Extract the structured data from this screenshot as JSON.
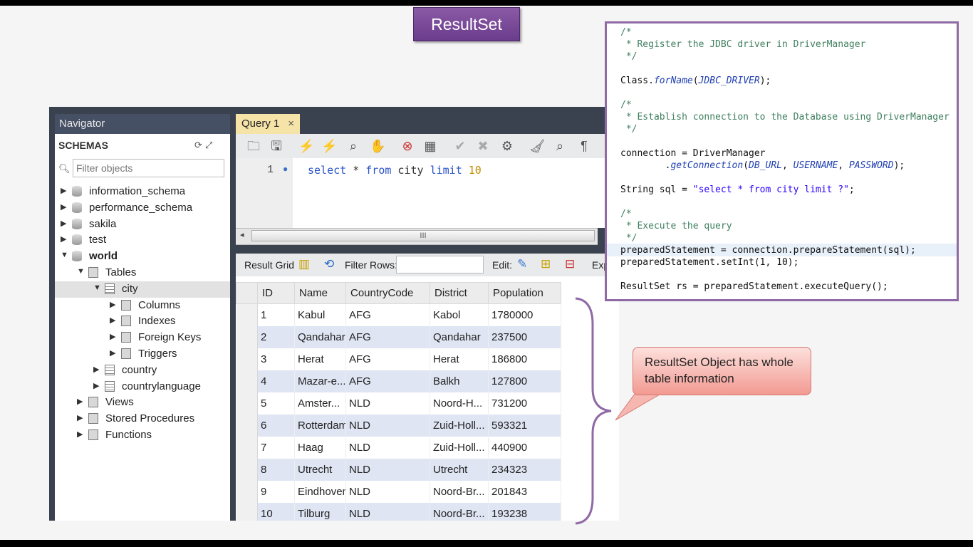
{
  "slide_title": "ResultSet",
  "navigator": {
    "title": "Navigator",
    "schemas_label": "SCHEMAS",
    "filter_placeholder": "Filter objects",
    "tree": [
      {
        "label": "information_schema",
        "level": 0,
        "icon": "database-icon",
        "expanded": false
      },
      {
        "label": "performance_schema",
        "level": 0,
        "icon": "database-icon",
        "expanded": false
      },
      {
        "label": "sakila",
        "level": 0,
        "icon": "database-icon",
        "expanded": false
      },
      {
        "label": "test",
        "level": 0,
        "icon": "database-icon",
        "expanded": false
      },
      {
        "label": "world",
        "level": 0,
        "icon": "database-icon",
        "expanded": true,
        "bold": true
      },
      {
        "label": "Tables",
        "level": 1,
        "icon": "folder-icon",
        "expanded": true
      },
      {
        "label": "city",
        "level": 2,
        "icon": "table-icon",
        "expanded": true,
        "selected": true
      },
      {
        "label": "Columns",
        "level": 3,
        "icon": "columns-icon",
        "expanded": false
      },
      {
        "label": "Indexes",
        "level": 3,
        "icon": "indexes-icon",
        "expanded": false
      },
      {
        "label": "Foreign Keys",
        "level": 3,
        "icon": "foreign-keys-icon",
        "expanded": false
      },
      {
        "label": "Triggers",
        "level": 3,
        "icon": "triggers-icon",
        "expanded": false
      },
      {
        "label": "country",
        "level": 2,
        "icon": "table-icon",
        "expanded": false
      },
      {
        "label": "countrylanguage",
        "level": 2,
        "icon": "table-icon",
        "expanded": false
      },
      {
        "label": "Views",
        "level": 1,
        "icon": "folder-icon",
        "expanded": false
      },
      {
        "label": "Stored Procedures",
        "level": 1,
        "icon": "folder-icon",
        "expanded": false
      },
      {
        "label": "Functions",
        "level": 1,
        "icon": "folder-icon",
        "expanded": false
      }
    ]
  },
  "query": {
    "tab_label": "Query 1",
    "tab_close": "×",
    "line_number": "1",
    "sql_tokens": [
      {
        "text": "select",
        "cls": "kw"
      },
      {
        "text": " * ",
        "cls": ""
      },
      {
        "text": "from",
        "cls": "kw"
      },
      {
        "text": " city ",
        "cls": ""
      },
      {
        "text": "limit",
        "cls": "kw"
      },
      {
        "text": " ",
        "cls": ""
      },
      {
        "text": "10",
        "cls": "num"
      }
    ],
    "scroll_thumb": "III"
  },
  "result": {
    "result_grid_label": "Result Grid",
    "filter_rows_label": "Filter Rows:",
    "edit_label": "Edit:",
    "export_label": "Exp",
    "columns": [
      "ID",
      "Name",
      "CountryCode",
      "District",
      "Population"
    ],
    "rows": [
      [
        "1",
        "Kabul",
        "AFG",
        "Kabol",
        "1780000"
      ],
      [
        "2",
        "Qandahar",
        "AFG",
        "Qandahar",
        "237500"
      ],
      [
        "3",
        "Herat",
        "AFG",
        "Herat",
        "186800"
      ],
      [
        "4",
        "Mazar-e...",
        "AFG",
        "Balkh",
        "127800"
      ],
      [
        "5",
        "Amster...",
        "NLD",
        "Noord-H...",
        "731200"
      ],
      [
        "6",
        "Rotterdam",
        "NLD",
        "Zuid-Holl...",
        "593321"
      ],
      [
        "7",
        "Haag",
        "NLD",
        "Zuid-Holl...",
        "440900"
      ],
      [
        "8",
        "Utrecht",
        "NLD",
        "Utrecht",
        "234323"
      ],
      [
        "9",
        "Eindhoven",
        "NLD",
        "Noord-Br...",
        "201843"
      ],
      [
        "10",
        "Tilburg",
        "NLD",
        "Noord-Br...",
        "193238"
      ]
    ]
  },
  "code_panel": {
    "lines": [
      [
        {
          "t": "/*",
          "c": "cm"
        }
      ],
      [
        {
          "t": " * Register the JDBC driver in DriverManager",
          "c": "cm"
        }
      ],
      [
        {
          "t": " */",
          "c": "cm"
        }
      ],
      [],
      [
        {
          "t": "Class.",
          "c": ""
        },
        {
          "t": "forName",
          "c": "it"
        },
        {
          "t": "(",
          "c": ""
        },
        {
          "t": "JDBC_DRIVER",
          "c": "it"
        },
        {
          "t": ");",
          "c": ""
        }
      ],
      [],
      [
        {
          "t": "/*",
          "c": "cm"
        }
      ],
      [
        {
          "t": " * Establish connection to the Database using DriverManager",
          "c": "cm"
        }
      ],
      [
        {
          "t": " */",
          "c": "cm"
        }
      ],
      [],
      [
        {
          "t": "connection = DriverManager",
          "c": ""
        }
      ],
      [
        {
          "t": "        .",
          "c": ""
        },
        {
          "t": "getConnection",
          "c": "it"
        },
        {
          "t": "(",
          "c": ""
        },
        {
          "t": "DB_URL",
          "c": "it"
        },
        {
          "t": ", ",
          "c": ""
        },
        {
          "t": "USERNAME",
          "c": "it"
        },
        {
          "t": ", ",
          "c": ""
        },
        {
          "t": "PASSWORD",
          "c": "it"
        },
        {
          "t": ");",
          "c": ""
        }
      ],
      [],
      [
        {
          "t": "String sql = ",
          "c": ""
        },
        {
          "t": "\"select * from city limit ?\"",
          "c": "str"
        },
        {
          "t": ";",
          "c": ""
        }
      ],
      [],
      [
        {
          "t": "/*",
          "c": "cm"
        }
      ],
      [
        {
          "t": " * Execute the query",
          "c": "cm"
        }
      ],
      [
        {
          "t": " */",
          "c": "cm"
        }
      ],
      [
        {
          "t": "preparedStatement = connection.prepareStatement(sql);",
          "c": ""
        }
      ],
      [
        {
          "t": "preparedStatement.setInt(1, 10);",
          "c": ""
        }
      ],
      [],
      [
        {
          "t": "ResultSet rs = preparedStatement.executeQuery();",
          "c": ""
        }
      ]
    ]
  },
  "callout_text": "ResultSet Object has  whole table information",
  "colors": {
    "title_bg": "#7b4b9a",
    "panel_border": "#8f6aa6",
    "callout_bg": "#f4aaa2",
    "tab_bg": "#f6e3a8",
    "row_alt": "#dfe5f3",
    "brace": "#8f6aa6"
  }
}
